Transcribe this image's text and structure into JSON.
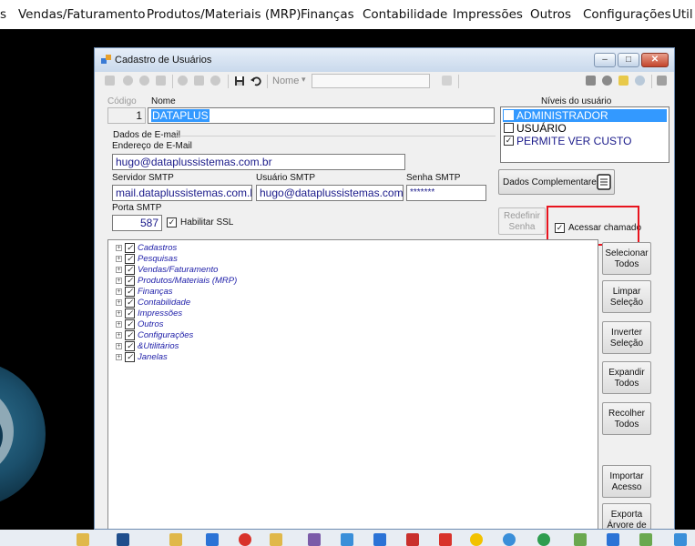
{
  "menubar": {
    "items": [
      "s",
      "Vendas/Faturamento",
      "Produtos/Materiais (MRP)",
      "Finanças",
      "Contabilidade",
      "Impressões",
      "Outros",
      "Configurações",
      "Util"
    ]
  },
  "window": {
    "title": "Cadastro de Usuários",
    "buttons": {
      "minimize": "–",
      "maximize": "□",
      "close": "✕"
    }
  },
  "toolbar": {
    "filter_label": "Nome",
    "filter_value": ""
  },
  "form": {
    "codigo_label": "Código",
    "codigo_value": "1",
    "nome_label": "Nome",
    "nome_value": "DATAPLUS",
    "email_group_label": "Dados de E-mail",
    "email_label": "Endereço de E-Mail",
    "email_value": "hugo@dataplussistemas.com.br",
    "smtp_server_label": "Servidor SMTP",
    "smtp_server_value": "mail.dataplussistemas.com.b",
    "smtp_user_label": "Usuário SMTP",
    "smtp_user_value": "hugo@dataplussistemas.com.l",
    "smtp_password_label": "Senha SMTP",
    "smtp_password_value": "*******",
    "smtp_port_label": "Porta SMTP",
    "smtp_port_value": "587",
    "ssl_label": "Habilitar SSL",
    "ssl_checked": true
  },
  "levels": {
    "title": "Níveis do usuário",
    "items": [
      {
        "label": "ADMINISTRADOR",
        "checked": false,
        "selected": true
      },
      {
        "label": "USUÁRIO",
        "checked": false,
        "selected": false
      },
      {
        "label": "PERMITE VER CUSTO",
        "checked": true,
        "selected": false
      }
    ]
  },
  "actions": {
    "dados_complementares": "Dados Complementares",
    "redefinir_senha_line1": "Redefinir",
    "redefinir_senha_line2": "Senha",
    "acessar_chamado": "Acessar chamado",
    "acessar_chamado_checked": true
  },
  "tree": {
    "nodes": [
      "Cadastros",
      "Pesquisas",
      "Vendas/Faturamento",
      "Produtos/Materiais (MRP)",
      "Finanças",
      "Contabilidade",
      "Impressões",
      "Outros",
      "Configurações",
      "&Utilitários",
      "Janelas"
    ]
  },
  "side_buttons": [
    {
      "line1": "Selecionar",
      "line2": "Todos"
    },
    {
      "line1": "Limpar",
      "line2": "Seleção"
    },
    {
      "line1": "Inverter",
      "line2": "Seleção"
    },
    {
      "line1": "Expandir",
      "line2": "Todos"
    },
    {
      "line1": "Recolher",
      "line2": "Todos"
    },
    {
      "line1": "Importar",
      "line2": "Acesso"
    },
    {
      "line1": "Exporta",
      "line2": "Árvore de"
    }
  ],
  "colors": {
    "selection": "#3399ff",
    "highlight_box": "#e8141e",
    "tree_text": "#2222aa"
  }
}
